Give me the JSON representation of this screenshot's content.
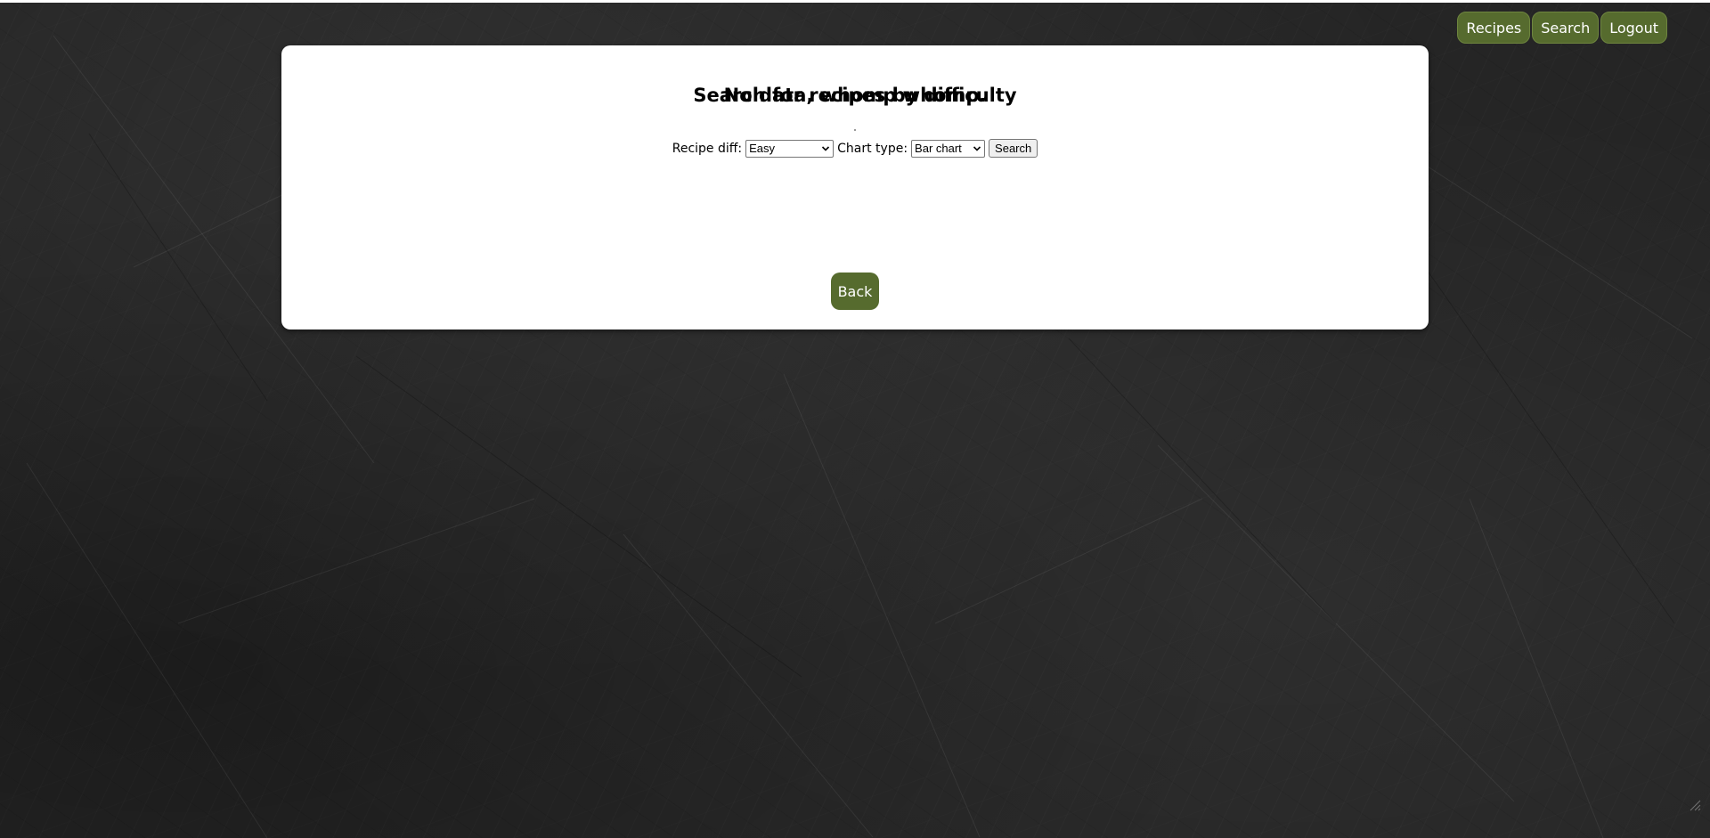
{
  "nav": {
    "recipes_label": "Recipes",
    "search_label": "Search",
    "logout_label": "Logout"
  },
  "card": {
    "title": "Search for recipes by difficulty",
    "form": {
      "difficulty_label": "Recipe diff:",
      "difficulty_selected": "Easy",
      "chart_type_label": "Chart type:",
      "chart_type_selected": "Bar chart",
      "search_button": "Search"
    },
    "message": "No data, whomp whomp.",
    "back_button": "Back"
  },
  "colors": {
    "accent": "#566b2e",
    "background": "#252525",
    "card": "#ffffff"
  },
  "icons": {
    "dropdown": "chevron-down-icon",
    "resize": "resize-grip-icon"
  }
}
